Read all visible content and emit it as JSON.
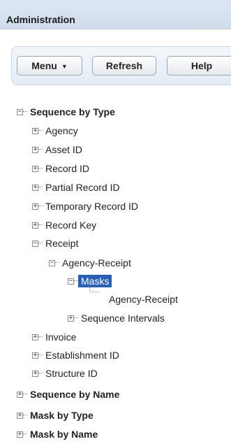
{
  "header": {
    "title": "Administration"
  },
  "toolbar": {
    "menu_label": "Menu",
    "menu_caret": "▼",
    "refresh_label": "Refresh",
    "help_label": "Help"
  },
  "tree": {
    "seq_by_type": {
      "label": "Sequence by Type",
      "toggle": "−"
    },
    "agency": {
      "label": "Agency",
      "toggle": "+"
    },
    "asset_id": {
      "label": "Asset ID",
      "toggle": "+"
    },
    "record_id": {
      "label": "Record ID",
      "toggle": "+"
    },
    "partial_record_id": {
      "label": "Partial Record ID",
      "toggle": "+"
    },
    "temporary_record_id": {
      "label": "Temporary Record ID",
      "toggle": "+"
    },
    "record_key": {
      "label": "Record Key",
      "toggle": "+"
    },
    "receipt": {
      "label": "Receipt",
      "toggle": "−"
    },
    "agency_receipt": {
      "label": "Agency-Receipt",
      "toggle": "−"
    },
    "masks": {
      "label": "Masks",
      "toggle": "−"
    },
    "masks_agency_receipt": {
      "label": "Agency-Receipt"
    },
    "sequence_intervals": {
      "label": "Sequence Intervals",
      "toggle": "+"
    },
    "invoice": {
      "label": "Invoice",
      "toggle": "+"
    },
    "establishment_id": {
      "label": "Establishment ID",
      "toggle": "+"
    },
    "structure_id": {
      "label": "Structure ID",
      "toggle": "+"
    },
    "seq_by_name": {
      "label": "Sequence by Name",
      "toggle": "+"
    },
    "mask_by_type": {
      "label": "Mask by Type",
      "toggle": "+"
    },
    "mask_by_name": {
      "label": "Mask by Name",
      "toggle": "+"
    }
  },
  "colors": {
    "selection": "#2b5fb6",
    "header_bg": "#d6e2ef",
    "toolbar_bg": "#eaf1f8"
  },
  "icons": {
    "expand": "plus-box-icon",
    "collapse": "minus-box-icon",
    "menu_dropdown": "chevron-down-icon"
  }
}
